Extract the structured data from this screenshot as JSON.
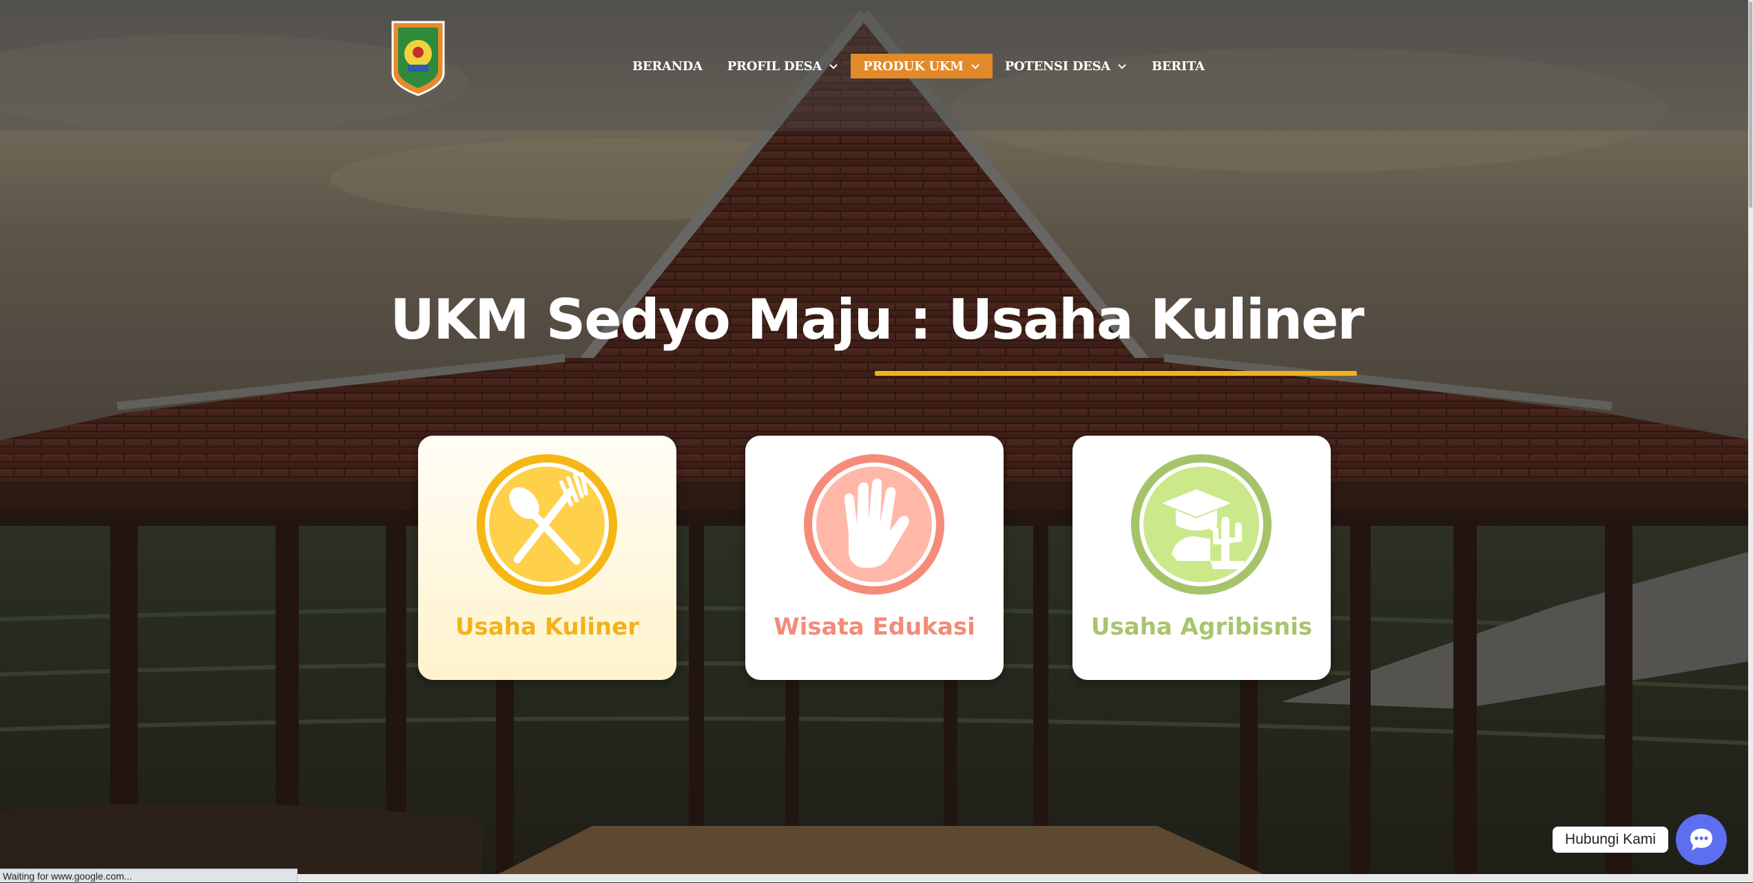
{
  "header": {
    "nav": [
      {
        "label": "BERANDA",
        "has_dropdown": false,
        "active": false
      },
      {
        "label": "PROFIL DESA",
        "has_dropdown": true,
        "active": false
      },
      {
        "label": "PRODUK UKM",
        "has_dropdown": true,
        "active": true
      },
      {
        "label": "POTENSI DESA",
        "has_dropdown": true,
        "active": false
      },
      {
        "label": "BERITA",
        "has_dropdown": false,
        "active": false
      }
    ]
  },
  "hero": {
    "title": "UKM Sedyo Maju : Usaha Kuliner"
  },
  "cards": [
    {
      "label": "Usaha Kuliner",
      "icon": "fork-spoon-icon",
      "color": "#f2b21b"
    },
    {
      "label": "Wisata Edukasi",
      "icon": "hand-icon",
      "color": "#f28b78"
    },
    {
      "label": "Usaha Agribisnis",
      "icon": "graduation-plant-icon",
      "color": "#a8c56c"
    }
  ],
  "contact": {
    "label": "Hubungi Kami",
    "icon": "chat-bubble-icon"
  },
  "status_bar": {
    "text": "Waiting for www.google.com..."
  },
  "colors": {
    "nav_active": "#e28a2a",
    "accent_underline": "#f2b21b",
    "contact_button": "#5b6ff0"
  }
}
